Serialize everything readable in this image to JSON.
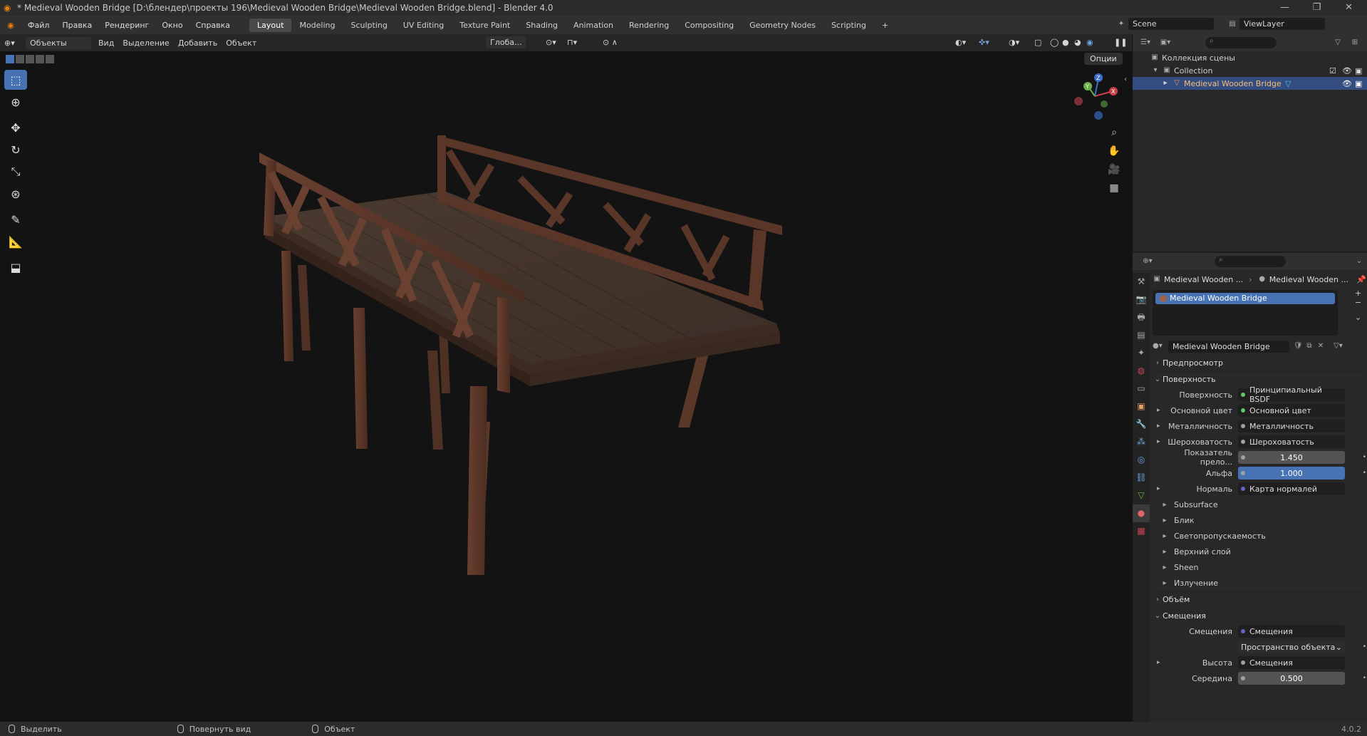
{
  "window": {
    "title": "* Medieval Wooden Bridge [D:\\блендер\\проекты 196\\Medieval Wooden Bridge\\Medieval Wooden Bridge.blend] - Blender 4.0"
  },
  "menubar": {
    "menus": [
      "Файл",
      "Правка",
      "Рендеринг",
      "Окно",
      "Справка"
    ],
    "workspaces": [
      "Layout",
      "Modeling",
      "Sculpting",
      "UV Editing",
      "Texture Paint",
      "Shading",
      "Animation",
      "Rendering",
      "Compositing",
      "Geometry Nodes",
      "Scripting"
    ],
    "active_workspace": "Layout",
    "add_tab": "+",
    "scene": "Scene",
    "view_layer": "ViewLayer"
  },
  "viewport_header": {
    "mode": "Объекты",
    "menus": [
      "Вид",
      "Выделение",
      "Добавить",
      "Объект"
    ],
    "orientation": "Глоба...",
    "options": "Опции"
  },
  "toolbar": {
    "tools": [
      "select-box",
      "cursor",
      "move",
      "rotate",
      "scale",
      "transform",
      "annotate",
      "measure",
      "add-cube"
    ],
    "active_tool": "select-box"
  },
  "gizmo": {
    "x": "X",
    "y": "Y",
    "z": "Z"
  },
  "outliner": {
    "root": "Коллекция сцены",
    "collection": "Collection",
    "object": "Medieval Wooden Bridge"
  },
  "properties": {
    "breadcrumb_object": "Medieval Wooden ...",
    "breadcrumb_material": "Medieval Wooden ...",
    "slot": "Medieval Wooden Bridge",
    "material_name": "Medieval Wooden Bridge",
    "panels": {
      "preview": "Предпросмотр",
      "surface": "Поверхность",
      "volume": "Объём",
      "displacement": "Смещения"
    },
    "surface_rows": [
      {
        "label": "Поверхность",
        "value": "Принципиальный BSDF",
        "kind": "link",
        "dot": "green"
      },
      {
        "label": "Основной цвет",
        "value": "Основной цвет",
        "kind": "link",
        "dot": "green",
        "expand": true
      },
      {
        "label": "Металличность",
        "value": "Металличность",
        "kind": "link",
        "dot": "grey",
        "expand": true
      },
      {
        "label": "Шероховатость",
        "value": "Шероховатость",
        "kind": "link",
        "dot": "grey",
        "expand": true
      },
      {
        "label": "Показатель прело...",
        "value": "1.450",
        "kind": "num",
        "dot": "grey"
      },
      {
        "label": "Альфа",
        "value": "1.000",
        "kind": "numblue",
        "dot": "grey"
      },
      {
        "label": "Нормаль",
        "value": "Карта нормалей",
        "kind": "link",
        "dot": "blue",
        "expand": true
      }
    ],
    "sub_panels": [
      "Subsurface",
      "Блик",
      "Светопропускаемость",
      "Верхний слой",
      "Sheen",
      "Излучение"
    ],
    "displacement_rows": [
      {
        "label": "Смещения",
        "value": "Смещения",
        "kind": "link",
        "dot": "blue"
      },
      {
        "label": "",
        "value": "Пространство объекта",
        "kind": "select"
      },
      {
        "label": "Высота",
        "value": "Смещения",
        "kind": "link",
        "dot": "grey",
        "expand": true
      },
      {
        "label": "Середина",
        "value": "0.500",
        "kind": "num",
        "dot": "grey"
      }
    ]
  },
  "statusbar": {
    "select": "Выделить",
    "rotate": "Повернуть вид",
    "object": "Объект",
    "version": "4.0.2"
  }
}
